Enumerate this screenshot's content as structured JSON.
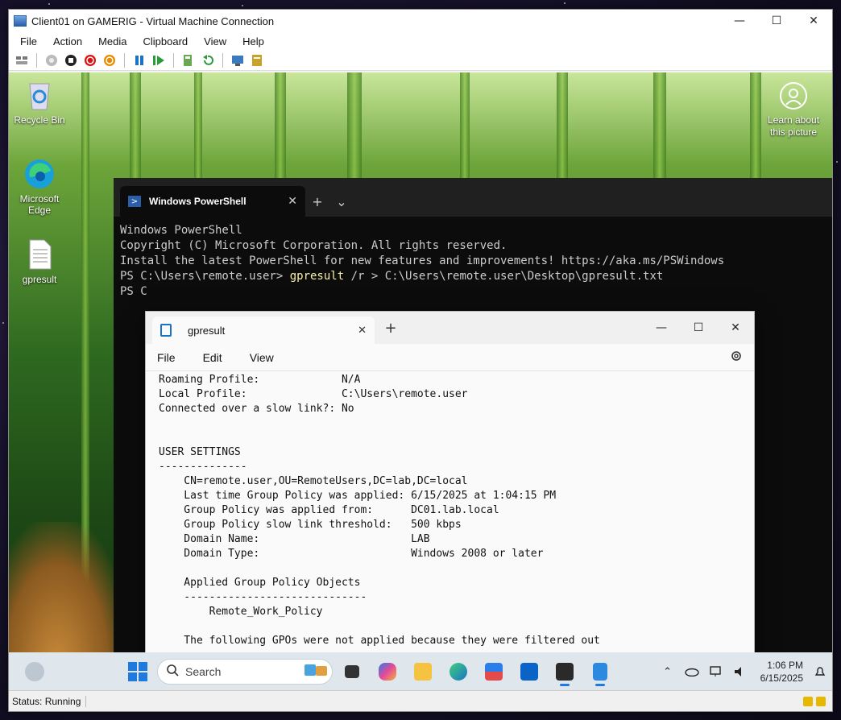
{
  "vm": {
    "title": "Client01 on GAMERIG - Virtual Machine Connection",
    "menu": [
      "File",
      "Action",
      "Media",
      "Clipboard",
      "View",
      "Help"
    ],
    "status": "Status: Running"
  },
  "desktop": {
    "icons": [
      {
        "label": "Recycle Bin",
        "icon": "recycle-bin-icon"
      },
      {
        "label": "Microsoft Edge",
        "icon": "edge-icon"
      },
      {
        "label": "gpresult",
        "icon": "text-file-icon"
      }
    ],
    "learn_about": "Learn about this picture"
  },
  "terminal": {
    "tab_title": "Windows PowerShell",
    "lines": [
      {
        "text": "Windows PowerShell"
      },
      {
        "text": "Copyright (C) Microsoft Corporation. All rights reserved."
      },
      {
        "text": ""
      },
      {
        "text": "Install the latest PowerShell for new features and improvements! https://aka.ms/PSWindows"
      },
      {
        "text": ""
      }
    ],
    "prompt": "PS C:\\Users\\remote.user> ",
    "command": "gpresult",
    "command_args": " /r > C:\\Users\\remote.user\\Desktop\\gpresult.txt",
    "next_prompt": "PS C"
  },
  "notepad": {
    "tab_title": "gpresult",
    "menu": [
      "File",
      "Edit",
      "View"
    ],
    "content": "Roaming Profile:             N/A\nLocal Profile:               C:\\Users\\remote.user\nConnected over a slow link?: No\n\n\nUSER SETTINGS\n--------------\n    CN=remote.user,OU=RemoteUsers,DC=lab,DC=local\n    Last time Group Policy was applied: 6/15/2025 at 1:04:15 PM\n    Group Policy was applied from:      DC01.lab.local\n    Group Policy slow link threshold:   500 kbps\n    Domain Name:                        LAB\n    Domain Type:                        Windows 2008 or later\n\n    Applied Group Policy Objects\n    -----------------------------\n        Remote_Work_Policy\n\n    The following GPOs were not applied because they were filtered out"
  },
  "taskbar": {
    "search_placeholder": "Search",
    "time": "1:06 PM",
    "date": "6/15/2025"
  }
}
